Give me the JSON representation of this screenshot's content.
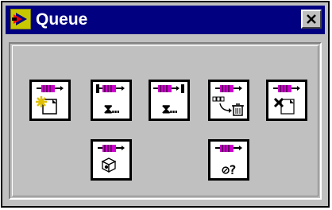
{
  "window": {
    "title": "Queue",
    "title_icon": "labview-vi-icon",
    "close_icon": "close-icon"
  },
  "colors": {
    "titlebar": "#000080",
    "window_bg": "#c0c0c0",
    "queue_magenta": "#cc00cc",
    "tool_border": "#000000"
  },
  "tools": [
    {
      "icon": "obtain-queue-icon",
      "label": ""
    },
    {
      "icon": "enqueue-element-at-opposite-end-icon",
      "label": "⧗…"
    },
    {
      "icon": "enqueue-element-icon",
      "label": "⧗…"
    },
    {
      "icon": "flush-queue-icon",
      "label": ""
    },
    {
      "icon": "release-queue-icon",
      "label": ""
    },
    {
      "icon": "preview-queue-element-icon",
      "label": ""
    },
    {
      "icon": "get-queue-status-icon",
      "label": "⊘?"
    }
  ]
}
